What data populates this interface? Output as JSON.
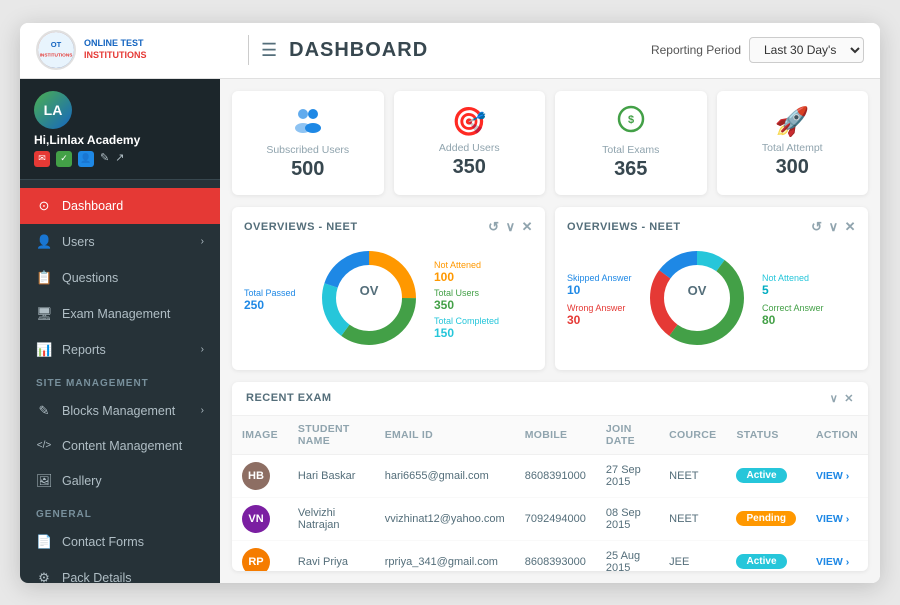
{
  "header": {
    "logo_text_top": "ONLINE TEST",
    "logo_text_bottom": "INSTITUTIONS",
    "logo_abbr": "OT",
    "title": "DASHBOARD",
    "reporting_label": "Reporting Period",
    "reporting_value": "Last 30 Day's"
  },
  "sidebar": {
    "profile_name": "Hi,Linlax Academy",
    "profile_initials": "LA",
    "nav_items": [
      {
        "id": "dashboard",
        "label": "Dashboard",
        "icon": "⊙",
        "active": true
      },
      {
        "id": "users",
        "label": "Users",
        "icon": "👤",
        "has_arrow": true
      },
      {
        "id": "questions",
        "label": "Questions",
        "icon": "📋",
        "has_arrow": false
      },
      {
        "id": "exam-management",
        "label": "Exam Management",
        "icon": "🖥",
        "has_arrow": false
      },
      {
        "id": "reports",
        "label": "Reports",
        "icon": "📊",
        "has_arrow": true
      }
    ],
    "site_management_label": "SITE MANAGEMENT",
    "site_items": [
      {
        "id": "blocks",
        "label": "Blocks Management",
        "icon": "✎",
        "has_arrow": true
      },
      {
        "id": "content",
        "label": "Content Management",
        "icon": "</>",
        "has_arrow": false
      },
      {
        "id": "gallery",
        "label": "Gallery",
        "icon": "🖼",
        "has_arrow": false
      }
    ],
    "general_label": "GENERAL",
    "general_items": [
      {
        "id": "contact-forms",
        "label": "Contact Forms",
        "icon": "📄",
        "has_arrow": false
      },
      {
        "id": "pack-details",
        "label": "Pack Details",
        "icon": "⚙",
        "has_arrow": false
      }
    ]
  },
  "stats": [
    {
      "id": "subscribed-users",
      "label": "Subscribed Users",
      "value": "500",
      "icon": "👥",
      "icon_color": "#1e88e5"
    },
    {
      "id": "added-users",
      "label": "Added Users",
      "value": "350",
      "icon": "🎯",
      "icon_color": "#ff9800"
    },
    {
      "id": "total-exams",
      "label": "Total Exams",
      "value": "365",
      "icon": "💲",
      "icon_color": "#43a047"
    },
    {
      "id": "total-attempt",
      "label": "Total Attempt",
      "value": "300",
      "icon": "🚀",
      "icon_color": "#26c6da"
    }
  ],
  "overviews": [
    {
      "id": "overview-left",
      "title": "OVERVIEWS - NEET",
      "center_label": "OV",
      "legends_left": [
        {
          "title": "Total Passed",
          "value": "250",
          "color_class": "lv-blue"
        }
      ],
      "legends_top": [
        {
          "title": "Not Attened",
          "value": "100",
          "color_class": "lv-orange"
        }
      ],
      "legends_right": [
        {
          "title": "Total Users",
          "value": "350",
          "color_class": "lv-green"
        }
      ],
      "legends_bottom": [
        {
          "title": "Total Completed",
          "value": "150",
          "color_class": "lv-teal"
        }
      ],
      "donut_segments": [
        {
          "color": "#ff9800",
          "pct": 25
        },
        {
          "color": "#43a047",
          "pct": 35
        },
        {
          "color": "#26c6da",
          "pct": 20
        },
        {
          "color": "#1e88e5",
          "pct": 20
        }
      ]
    },
    {
      "id": "overview-right",
      "title": "OVERVIEWS - NEET",
      "center_label": "OV",
      "legends": [
        {
          "title": "Not Attened",
          "value": "5",
          "color_class": "lv-cyan"
        },
        {
          "title": "Correct Answer",
          "value": "80",
          "color_class": "lv-green"
        },
        {
          "title": "Wrong Answer",
          "value": "30",
          "color_class": "lv-red"
        },
        {
          "title": "Skipped Answer",
          "value": "10",
          "color_class": "lv-blue"
        }
      ],
      "donut_segments": [
        {
          "color": "#26c6da",
          "pct": 10
        },
        {
          "color": "#43a047",
          "pct": 50
        },
        {
          "color": "#e53935",
          "pct": 25
        },
        {
          "color": "#1e88e5",
          "pct": 15
        }
      ]
    }
  ],
  "recent_exam": {
    "title": "RECENT EXAM",
    "columns": [
      "IMAGE",
      "STUDENT NAME",
      "EMAIL ID",
      "MOBILE",
      "JOIN DATE",
      "COURCE",
      "STATUS",
      "ACTION"
    ],
    "rows": [
      {
        "initials": "HB",
        "av_class": "av-brown",
        "name": "Hari Baskar",
        "email": "hari6655@gmail.com",
        "mobile": "8608391000",
        "join_date": "27 Sep 2015",
        "course": "NEET",
        "status": "Active",
        "status_class": "badge-active",
        "action": "VIEW ›"
      },
      {
        "initials": "VN",
        "av_class": "av-purple",
        "name": "Velvizhi Natrajan",
        "email": "vvizhinat12@yahoo.com",
        "mobile": "7092494000",
        "join_date": "08 Sep 2015",
        "course": "NEET",
        "status": "Pending",
        "status_class": "badge-pending",
        "action": "VIEW ›"
      },
      {
        "initials": "RP",
        "av_class": "av-orange",
        "name": "Ravi Priya",
        "email": "rpriya_341@gmail.com",
        "mobile": "8608393000",
        "join_date": "25 Aug 2015",
        "course": "JEE",
        "status": "Active",
        "status_class": "badge-active",
        "action": "VIEW ›"
      }
    ]
  }
}
